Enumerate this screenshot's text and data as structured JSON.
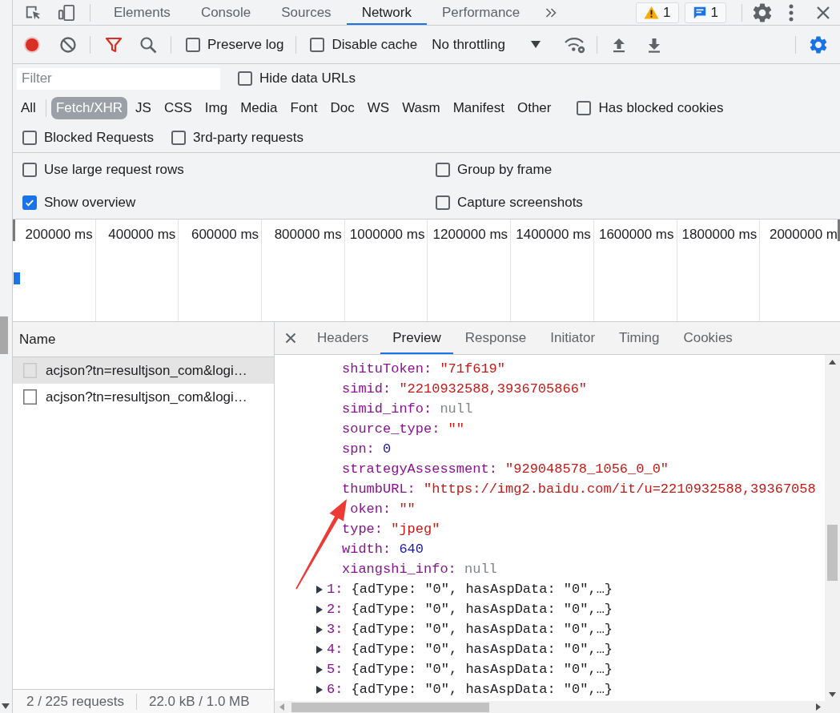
{
  "tab_bar": {
    "tabs": [
      {
        "label": "Elements",
        "selected": false
      },
      {
        "label": "Console",
        "selected": false
      },
      {
        "label": "Sources",
        "selected": false
      },
      {
        "label": "Network",
        "selected": true
      },
      {
        "label": "Performance",
        "selected": false
      }
    ],
    "warnings": "1",
    "messages": "1"
  },
  "toolbar": {
    "recording": true,
    "filter_shown": true,
    "preserve_log": {
      "label": "Preserve log",
      "checked": false
    },
    "disable_cache": {
      "label": "Disable cache",
      "checked": false
    },
    "throttling": "No throttling",
    "settings_shown": true
  },
  "filter_bar": {
    "filter": {
      "placeholder": "Filter"
    },
    "hide_data_urls": {
      "label": "Hide data URLs",
      "checked": false
    },
    "types": [
      {
        "label": "All",
        "selected": false
      },
      {
        "label": "Fetch/XHR",
        "selected": true
      },
      {
        "label": "JS",
        "selected": false
      },
      {
        "label": "CSS",
        "selected": false
      },
      {
        "label": "Img",
        "selected": false
      },
      {
        "label": "Media",
        "selected": false
      },
      {
        "label": "Font",
        "selected": false
      },
      {
        "label": "Doc",
        "selected": false
      },
      {
        "label": "WS",
        "selected": false
      },
      {
        "label": "Wasm",
        "selected": false
      },
      {
        "label": "Manifest",
        "selected": false
      },
      {
        "label": "Other",
        "selected": false
      }
    ],
    "has_blocked_cookies": {
      "label": "Has blocked cookies",
      "checked": false
    },
    "blocked_requests": {
      "label": "Blocked Requests",
      "checked": false
    },
    "third_party": {
      "label": "3rd-party requests",
      "checked": false
    }
  },
  "settings": [
    {
      "label": "Use large request rows",
      "checked": false
    },
    {
      "label": "Group by frame",
      "checked": false
    },
    {
      "label": "Show overview",
      "checked": true
    },
    {
      "label": "Capture screenshots",
      "checked": false
    }
  ],
  "overview": {
    "time_labels": [
      "200000 ms",
      "400000 ms",
      "600000 ms",
      "800000 ms",
      "1000000 ms",
      "1200000 ms",
      "1400000 ms",
      "1600000 ms",
      "1800000 ms",
      "2000000 m"
    ]
  },
  "requests": {
    "column": "Name",
    "rows": [
      {
        "name": "acjson?tn=resultjson_com&logi…",
        "selected": true
      },
      {
        "name": "acjson?tn=resultjson_com&logi…",
        "selected": false
      }
    ],
    "status": [
      "2 / 225 requests",
      "22.0 kB / 1.0 MB"
    ]
  },
  "details": {
    "tabs": [
      {
        "label": "Headers",
        "selected": false
      },
      {
        "label": "Preview",
        "selected": true
      },
      {
        "label": "Response",
        "selected": false
      },
      {
        "label": "Initiator",
        "selected": false
      },
      {
        "label": "Timing",
        "selected": false
      },
      {
        "label": "Cookies",
        "selected": false
      }
    ],
    "preview": {
      "properties": [
        {
          "key": "shituToken:",
          "value": "\"71f619\"",
          "kind": "string",
          "under_arrow": false
        },
        {
          "key": "simid:",
          "value": "\"2210932588,3936705866\"",
          "kind": "string",
          "under_arrow": false
        },
        {
          "key": "simid_info:",
          "value": "null",
          "kind": "null",
          "under_arrow": false
        },
        {
          "key": "source_type:",
          "value": "\"\"",
          "kind": "string",
          "under_arrow": false
        },
        {
          "key": "spn:",
          "value": "0",
          "kind": "number",
          "under_arrow": false
        },
        {
          "key": "strategyAssessment:",
          "value": "\"929048578_1056_0_0\"",
          "kind": "string",
          "under_arrow": false
        },
        {
          "key": "thumbURL:",
          "value": "\"https://img2.baidu.com/it/u=2210932588,39367058",
          "kind": "string",
          "under_arrow": false
        },
        {
          "key": "oken:",
          "value": "\"\"",
          "kind": "string",
          "under_arrow": true
        },
        {
          "key": "type:",
          "value": "\"jpeg\"",
          "kind": "string",
          "under_arrow": false
        },
        {
          "key": "width:",
          "value": "640",
          "kind": "number",
          "under_arrow": false
        },
        {
          "key": "xiangshi_info:",
          "value": "null",
          "kind": "null",
          "under_arrow": false
        }
      ],
      "entries": [
        {
          "key": "1:",
          "summary": "{adType: \"0\", hasAspData: \"0\",…}",
          "expanded": false
        },
        {
          "key": "2:",
          "summary": "{adType: \"0\", hasAspData: \"0\",…}",
          "expanded": false
        },
        {
          "key": "3:",
          "summary": "{adType: \"0\", hasAspData: \"0\",…}",
          "expanded": false
        },
        {
          "key": "4:",
          "summary": "{adType: \"0\", hasAspData: \"0\",…}",
          "expanded": false
        },
        {
          "key": "5:",
          "summary": "{adType: \"0\", hasAspData: \"0\",…}",
          "expanded": false
        },
        {
          "key": "6:",
          "summary": "{adType: \"0\", hasAspData: \"0\",…}",
          "expanded": false
        }
      ]
    }
  }
}
